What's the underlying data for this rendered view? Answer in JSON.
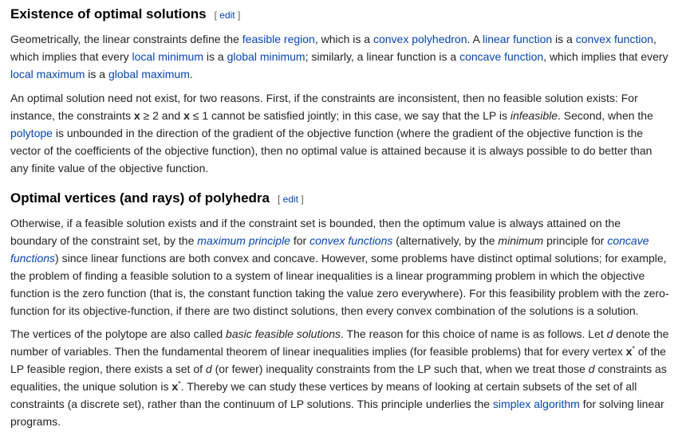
{
  "s1": {
    "title": "Existence of optimal solutions",
    "edit": "edit",
    "p1": {
      "l1_a": "Geometrically, the linear constraints define the ",
      "l1_link1": "feasible region",
      "l1_b": ", which is a ",
      "l1_link2": "convex polyhedron",
      "l1_c": ". A ",
      "l1_link3": "linear function",
      "l1_d": " is a ",
      "l1_link4": "convex function",
      "l1_e": ",",
      "l2_a": "which implies that every ",
      "l2_link1": "local minimum",
      "l2_b": " is a ",
      "l2_link2": "global minimum",
      "l2_c": "; similarly, a linear function is a ",
      "l2_link3": "concave function",
      "l2_d": ", which implies that every",
      "l3_link1": "local maximum",
      "l3_a": " is a ",
      "l3_link2": "global maximum",
      "l3_b": "."
    },
    "p2": {
      "l1": "An optimal solution need not exist, for two reasons. First, if the constraints are inconsistent, then no feasible solution exists: For",
      "l2_a": "instance, the constraints ",
      "l2_x1": "x",
      "l2_b": " ≥ 2 and ",
      "l2_x2": "x",
      "l2_c": " ≤ 1 cannot be satisfied jointly; in this case, we say that the LP is ",
      "l2_i": "infeasible",
      "l2_d": ". Second, when the",
      "l3_link": "polytope",
      "l3_a": " is unbounded in the direction of the gradient of the objective function (where the gradient of the objective function is the",
      "l4": "vector of the coefficients of the objective function), then no optimal value is attained because it is always possible to do better than",
      "l5": "any finite value of the objective function."
    }
  },
  "s2": {
    "title": "Optimal vertices (and rays) of polyhedra",
    "edit": "edit",
    "p1": {
      "l1": "Otherwise, if a feasible solution exists and if the constraint set is bounded, then the optimum value is always attained on the",
      "l2_a": "boundary of the constraint set, by the ",
      "l2_link1": "maximum principle",
      "l2_b": " for ",
      "l2_link2": "convex functions",
      "l2_c": " (alternatively, by the ",
      "l2_i": "minimum",
      "l2_d": " principle for ",
      "l2_link3": "concave",
      "l3_link": "functions",
      "l3_a": ") since linear functions are both convex and concave. However, some problems have distinct optimal solutions; for example,",
      "l4": "the problem of finding a feasible solution to a system of linear inequalities is a linear programming problem in which the objective",
      "l5": "function is the zero function (that is, the constant function taking the value zero everywhere). For this feasibility problem with the zero-",
      "l6": "function for its objective-function, if there are two distinct solutions, then every convex combination of the solutions is a solution."
    },
    "p2": {
      "l1_a": "The vertices of the polytope are also called ",
      "l1_i": "basic feasible solutions",
      "l1_b": ". The reason for this choice of name is as follows. Let ",
      "l1_d": "d",
      "l1_c": " denote the",
      "l2_a": "number of variables. Then the fundamental theorem of linear inequalities implies (for feasible problems) that for every vertex ",
      "l2_x": "x",
      "l2_sup": "*",
      "l2_b": " of the",
      "l3_a": "LP feasible region, there exists a set of ",
      "l3_d1": "d",
      "l3_b": " (or fewer) inequality constraints from the LP such that, when we treat those ",
      "l3_d2": "d",
      "l3_c": " constraints as",
      "l4_a": "equalities, the unique solution is ",
      "l4_x": "x",
      "l4_sup": "*",
      "l4_b": ". Thereby we can study these vertices by means of looking at certain subsets of the set of all",
      "l5": "constraints (a discrete set), rather than the continuum of LP solutions. This principle underlies the ",
      "l5_link": "simplex algorithm",
      "l5_b": " for solving linear",
      "l6": "programs."
    }
  }
}
